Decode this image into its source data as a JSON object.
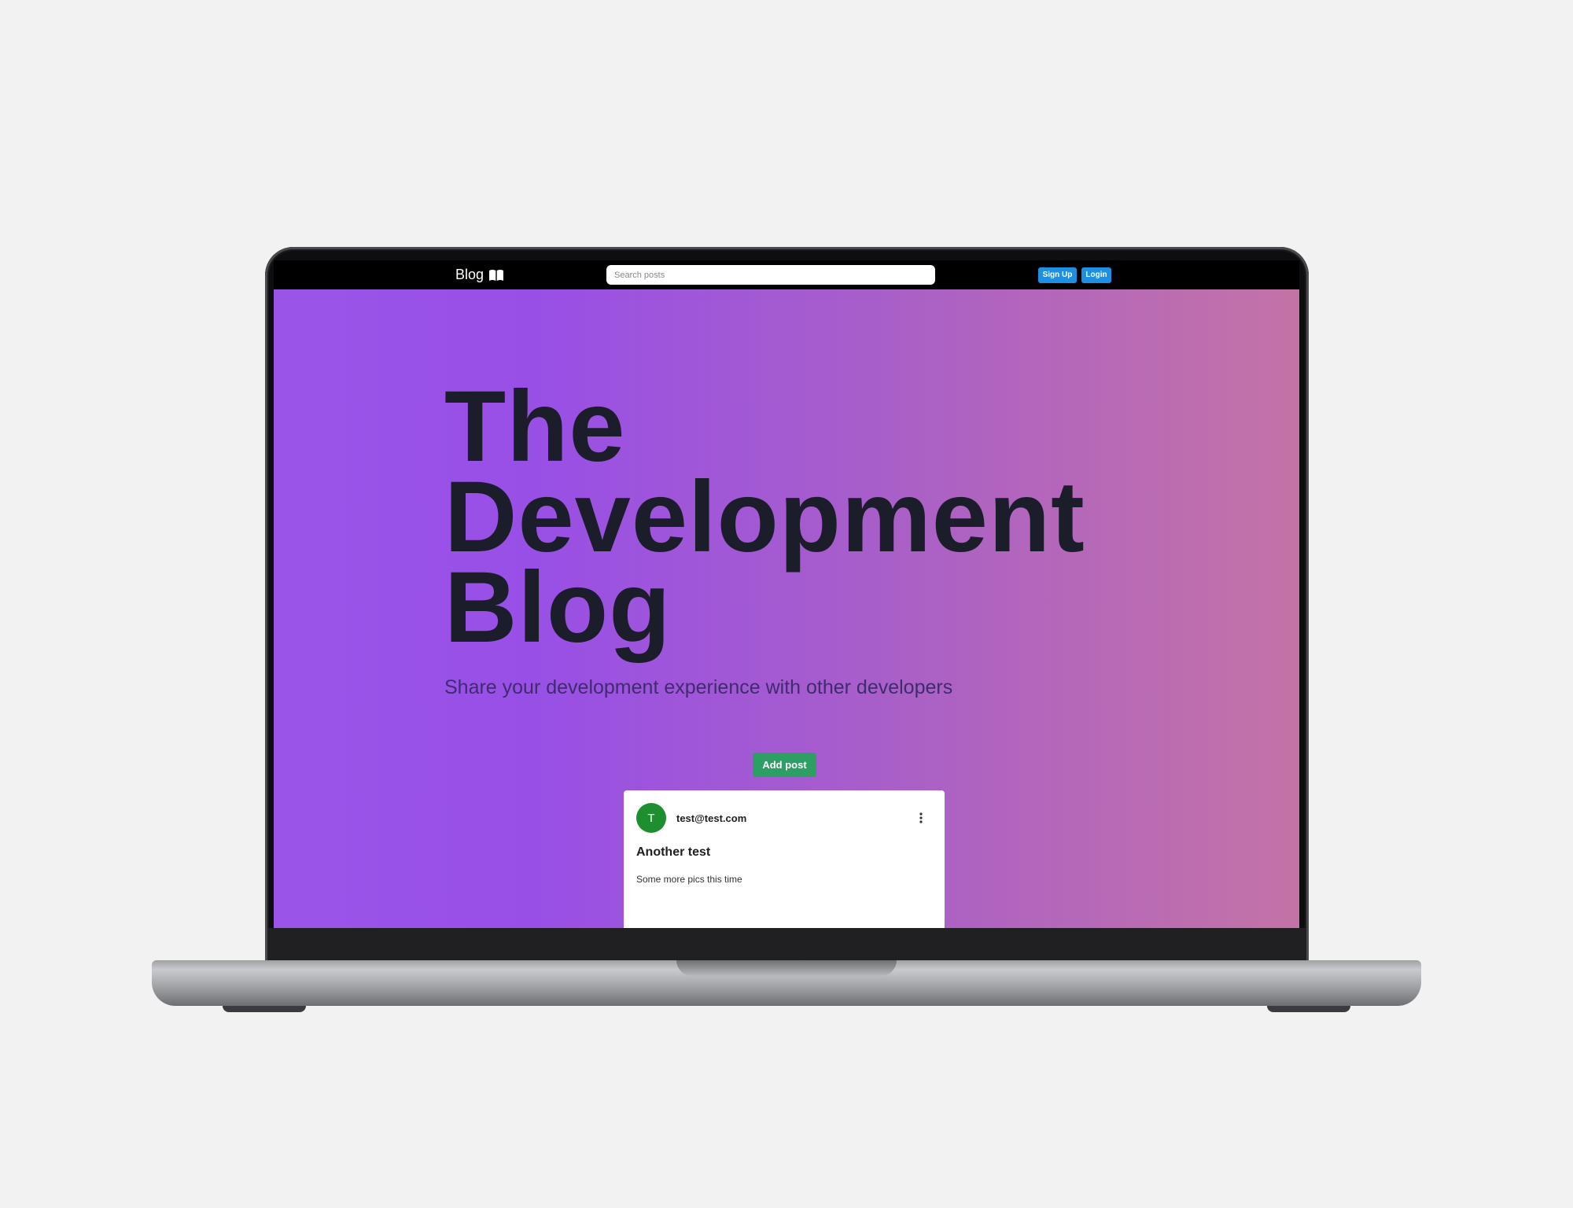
{
  "navbar": {
    "brand": "Blog",
    "brand_icon": "open-book-icon",
    "search_placeholder": "Search posts",
    "signup_label": "Sign Up",
    "login_label": "Login"
  },
  "hero": {
    "title_lines": [
      "The",
      "Development",
      "Blog"
    ],
    "subtitle": "Share your development experience with other developers"
  },
  "actions": {
    "add_post_label": "Add post"
  },
  "posts": [
    {
      "avatar_letter": "T",
      "author": "test@test.com",
      "title": "Another test",
      "body": "Some more pics this time",
      "menu_icon": "more-vertical-icon"
    }
  ],
  "colors": {
    "hero_gradient_start": "#9a55e8",
    "hero_gradient_end": "#c473a6",
    "title_color": "#1c1d2a",
    "nav_button": "#1e8fe1",
    "add_post_button": "#2e9f64",
    "avatar": "#1d8f2e"
  }
}
